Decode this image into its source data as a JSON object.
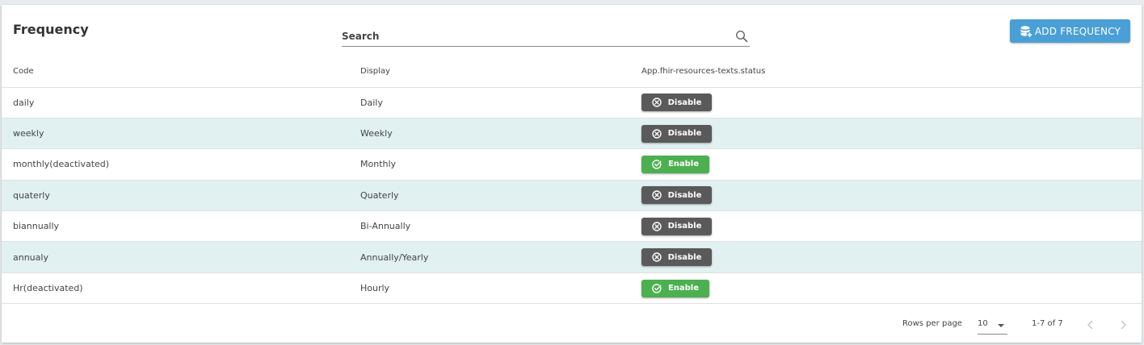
{
  "header": {
    "title": "Frequency",
    "search_placeholder": "Search",
    "add_label": "ADD FREQUENCY"
  },
  "table": {
    "columns": [
      "Code",
      "Display",
      "App.fhir-resources-texts.status"
    ],
    "rows": [
      {
        "code": "daily",
        "display": "Daily",
        "action": "Disable"
      },
      {
        "code": "weekly",
        "display": "Weekly",
        "action": "Disable"
      },
      {
        "code": "monthly(deactivated)",
        "display": "Monthly",
        "action": "Enable"
      },
      {
        "code": "quaterly",
        "display": "Quaterly",
        "action": "Disable"
      },
      {
        "code": "biannually",
        "display": "Bi-Annually",
        "action": "Disable"
      },
      {
        "code": "annualy",
        "display": "Annually/Yearly",
        "action": "Disable"
      },
      {
        "code": "Hr(deactivated)",
        "display": "Hourly",
        "action": "Enable"
      }
    ]
  },
  "footer": {
    "rows_per_page_label": "Rows per page",
    "rows_per_page_value": "10",
    "range": "1-7 of 7"
  },
  "colors": {
    "accent": "#4a9fd6",
    "disable_bg": "#5a5a5a",
    "enable_bg": "#4caf50",
    "row_alt": "#e1f1f1"
  },
  "icons": {
    "search": "search-icon",
    "add": "database-plus-icon",
    "disable": "circle-x-icon",
    "enable": "circle-check-icon",
    "prev": "chevron-left-icon",
    "next": "chevron-right-icon"
  }
}
